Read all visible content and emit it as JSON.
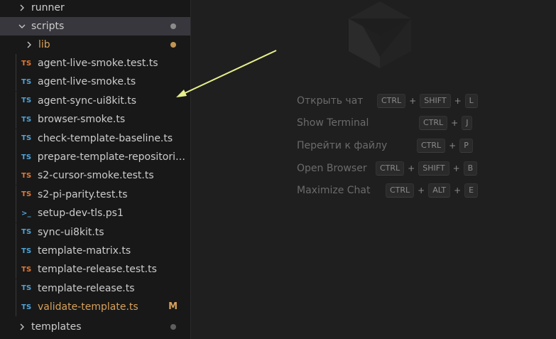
{
  "colors": {
    "ts_blue": "#4fa3d8",
    "ts_orange": "#e37933",
    "modified": "#d7a15a",
    "folder_dot_gray": "#8b8b8b",
    "lib_dot": "#c09553",
    "shell_icon": "#4fa3d8",
    "arrow": "#e6ef8a"
  },
  "tree": {
    "runner": "runner",
    "scripts": "scripts",
    "lib": "lib",
    "templates": "templates",
    "files": [
      {
        "type": "TS",
        "icon": "ts-test",
        "name": "agent-live-smoke.test.ts"
      },
      {
        "type": "TS",
        "icon": "ts",
        "name": "agent-live-smoke.ts"
      },
      {
        "type": "TS",
        "icon": "ts",
        "name": "agent-sync-ui8kit.ts"
      },
      {
        "type": "TS",
        "icon": "ts",
        "name": "browser-smoke.ts"
      },
      {
        "type": "TS",
        "icon": "ts",
        "name": "check-template-baseline.ts"
      },
      {
        "type": "TS",
        "icon": "ts",
        "name": "prepare-template-repositorie..."
      },
      {
        "type": "TS",
        "icon": "ts-test",
        "name": "s2-cursor-smoke.test.ts"
      },
      {
        "type": "TS",
        "icon": "ts-test",
        "name": "s2-pi-parity.test.ts"
      },
      {
        "type": ">_",
        "icon": "powershell",
        "name": "setup-dev-tls.ps1"
      },
      {
        "type": "TS",
        "icon": "ts",
        "name": "sync-ui8kit.ts"
      },
      {
        "type": "TS",
        "icon": "ts",
        "name": "template-matrix.ts"
      },
      {
        "type": "TS",
        "icon": "ts-test",
        "name": "template-release.test.ts"
      },
      {
        "type": "TS",
        "icon": "ts",
        "name": "template-release.ts"
      },
      {
        "type": "TS",
        "icon": "ts",
        "name": "validate-template.ts",
        "status": "M"
      }
    ]
  },
  "shortcuts": [
    {
      "label": "Открыть чат",
      "keys": [
        "CTRL",
        "SHIFT",
        "L"
      ]
    },
    {
      "label": "Show Terminal",
      "keys": [
        "CTRL",
        "J"
      ]
    },
    {
      "label": "Перейти к файлу",
      "keys": [
        "CTRL",
        "P"
      ]
    },
    {
      "label": "Open Browser",
      "keys": [
        "CTRL",
        "SHIFT",
        "B"
      ]
    },
    {
      "label": "Maximize Chat",
      "keys": [
        "CTRL",
        "ALT",
        "E"
      ]
    }
  ]
}
